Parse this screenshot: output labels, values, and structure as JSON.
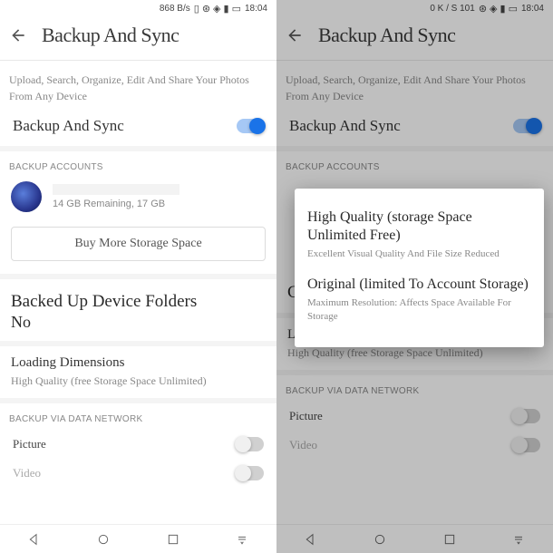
{
  "left": {
    "status": {
      "net": "868 B/s",
      "time": "18:04"
    },
    "header": {
      "title": "Backup And Sync"
    },
    "desc": "Upload, Search, Organize, Edit And Share Your Photos From Any Device",
    "toggle": {
      "label": "Backup And Sync",
      "on": true
    },
    "backup_accounts_label": "BACKUP ACCOUNTS",
    "account": {
      "remaining": "14 GB Remaining, 17 GB"
    },
    "buy_btn": "Buy More Storage Space",
    "folders_title": "Backed Up Device Folders",
    "folders_no": "No",
    "loading_title": "Loading Dimensions",
    "loading_sub": "High Quality (free Storage Space Unlimited)",
    "backup_via_label": "BACKUP VIA DATA NETWORK",
    "picture_label": "Picture",
    "video_label": "Video"
  },
  "right": {
    "status": {
      "net": "0 K / S 101",
      "time": "18:04"
    },
    "header": {
      "title": "Backup And Sync"
    },
    "desc": "Upload, Search, Organize, Edit And Share Your Photos From Any Device",
    "toggle": {
      "label": "Backup And Sync",
      "on": true
    },
    "backup_accounts_label": "BACKUP ACCOUNTS",
    "folders_c": "C",
    "loading_title": "Loading Dimensions",
    "loading_sub": "High Quality (free Storage Space Unlimited)",
    "backup_via_label": "BACKUP VIA DATA NETWORK",
    "picture_label": "Picture",
    "video_label": "Video",
    "dialog": {
      "opt1_title": "High Quality (storage Space Unlimited Free)",
      "opt1_sub": "Excellent Visual Quality And File Size Reduced",
      "opt2_title": "Original (limited To Account Storage)",
      "opt2_sub": "Maximum Resolution: Affects Space Available For Storage"
    }
  }
}
